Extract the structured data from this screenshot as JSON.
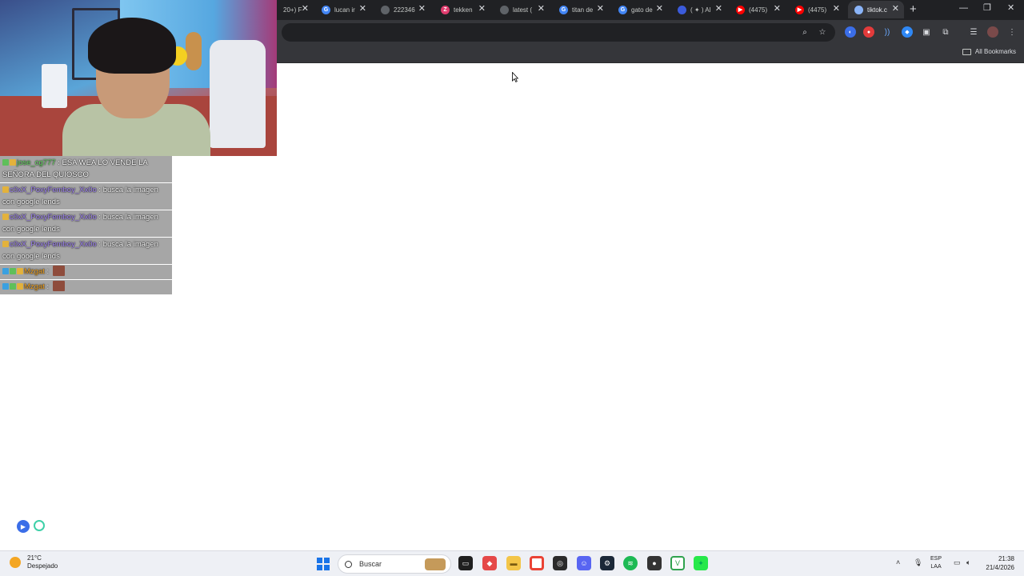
{
  "browser": {
    "tabs": [
      {
        "title": "20+) F",
        "color": "#202124",
        "glyph": ""
      },
      {
        "title": "lucan ir",
        "color": "#4285f4",
        "glyph": "G"
      },
      {
        "title": "222346",
        "color": "#5f6368",
        "glyph": ""
      },
      {
        "title": "tekken",
        "color": "#e03c6e",
        "glyph": "Z"
      },
      {
        "title": "latest (",
        "color": "#5f6368",
        "glyph": ""
      },
      {
        "title": "titan de",
        "color": "#4285f4",
        "glyph": "G"
      },
      {
        "title": "gato de",
        "color": "#4285f4",
        "glyph": "G"
      },
      {
        "title": "( ✦ ) Al",
        "color": "#3b5bdb",
        "glyph": ""
      },
      {
        "title": "(4475)",
        "color": "#ff0000",
        "glyph": "▶"
      },
      {
        "title": "(4475)",
        "color": "#ff0000",
        "glyph": "▶"
      },
      {
        "title": "tiktok.c",
        "color": "#8ab4f8",
        "glyph": ""
      }
    ],
    "new_tab_label": "+",
    "bookmarks_label": "All Bookmarks"
  },
  "chat": {
    "messages": [
      {
        "user": "jose_cg777",
        "user_color": "#6fe06a",
        "text": "ESA WEA LO VENDE LA SEÑORA DEL QUIOSCO",
        "badges": [
          "green",
          "crown"
        ],
        "emote": false
      },
      {
        "user": "c0xX_PoxyFemboy_Xx0o",
        "user_color": "#a78bfa",
        "text": "busca la imagen con google lends",
        "badges": [
          "crown"
        ],
        "emote": false
      },
      {
        "user": "c0xX_PoxyFemboy_Xx0o",
        "user_color": "#a78bfa",
        "text": "busca la imagen con google lends",
        "badges": [
          "crown"
        ],
        "emote": false
      },
      {
        "user": "c0xX_PoxyFemboy_Xx0o",
        "user_color": "#a78bfa",
        "text": "busca la imagen con google lends",
        "badges": [
          "crown"
        ],
        "emote": false
      },
      {
        "user": "Mzgat",
        "user_color": "#f5a623",
        "text": "",
        "badges": [
          "blue",
          "green",
          "crown"
        ],
        "emote": true
      },
      {
        "user": "Mzgat",
        "user_color": "#f5a623",
        "text": "",
        "badges": [
          "blue",
          "green",
          "crown"
        ],
        "emote": true
      }
    ]
  },
  "taskbar": {
    "weather_temp": "21°C",
    "weather_desc": "Despejado",
    "search_placeholder": "Buscar",
    "lang_top": "ESP",
    "lang_bottom": "LAA",
    "time": "21:38",
    "date": "21/4/2026"
  }
}
